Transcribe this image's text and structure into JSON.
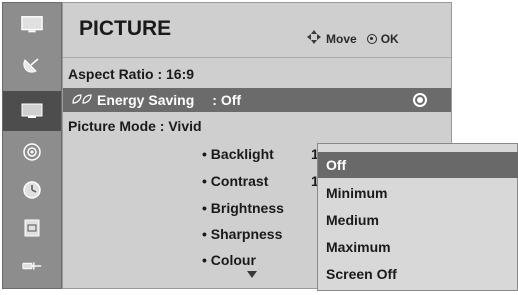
{
  "menu": {
    "title": "PICTURE",
    "hint_move": "Move",
    "hint_ok": "OK"
  },
  "sidebar": {
    "items": [
      {
        "icon": "tv-icon",
        "active": false
      },
      {
        "icon": "satellite-dish-icon",
        "active": false
      },
      {
        "icon": "picture-icon",
        "active": true
      },
      {
        "icon": "speaker-icon",
        "active": false
      },
      {
        "icon": "clock-icon",
        "active": false
      },
      {
        "icon": "lock-icon",
        "active": false
      },
      {
        "icon": "input-plug-icon",
        "active": false
      }
    ]
  },
  "settings": {
    "aspect_ratio": "Aspect Ratio   : 16:9",
    "energy_saving_label": "Energy Saving",
    "energy_saving_value": ": Off",
    "picture_mode": "Picture Mode  : Vivid",
    "sub_items": [
      {
        "label": "• Backlight",
        "value": "1"
      },
      {
        "label": "• Contrast",
        "value": "1"
      },
      {
        "label": "• Brightness",
        "value": ""
      },
      {
        "label": "• Sharpness",
        "value": ""
      },
      {
        "label": "• Colour",
        "value": ""
      }
    ]
  },
  "dropdown": {
    "options": [
      "Off",
      "Minimum",
      "Medium",
      "Maximum",
      "Screen Off"
    ],
    "selected": "Off"
  },
  "colors": {
    "highlight": "#6b6b6b",
    "panel": "#cfcfcf",
    "sidebar": "#8d8d8d"
  }
}
